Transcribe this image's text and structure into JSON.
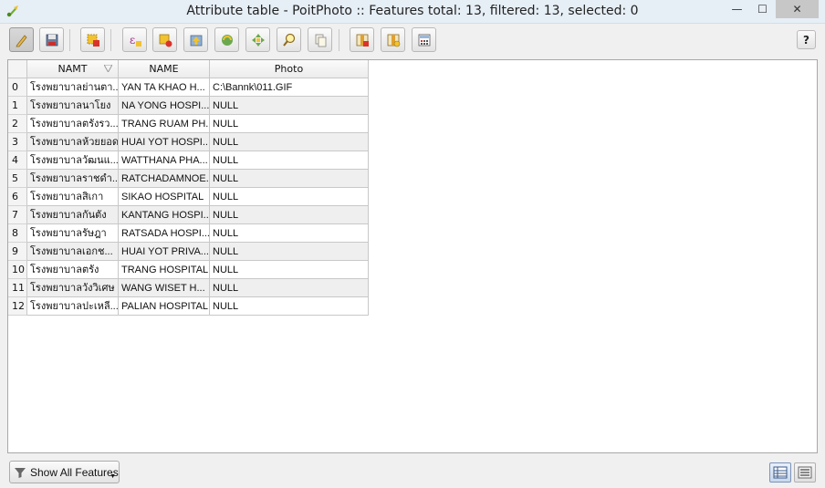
{
  "window": {
    "title": "Attribute table - PoitPhoto :: Features total: 13, filtered: 13, selected: 0",
    "minimize_glyph": "—",
    "maximize_glyph": "☐",
    "close_glyph": "✕"
  },
  "toolbar": {
    "help_label": "?",
    "icons": [
      "pencil-icon",
      "save-icon",
      "delete-selected-icon",
      "expression-select-icon",
      "deselect-icon",
      "move-selection-top-icon",
      "invert-selection-icon",
      "pan-to-selection-icon",
      "zoom-to-selection-icon",
      "copy-rows-icon",
      "delete-column-icon",
      "new-column-icon",
      "field-calculator-icon"
    ]
  },
  "table": {
    "columns": [
      "NAMT",
      "NAME",
      "Photo"
    ],
    "rows": [
      {
        "id": "0",
        "namt": "โรงพยาบาลย่านตา...",
        "name": "YAN TA KHAO H...",
        "photo": "C:\\Bannk\\011.GIF"
      },
      {
        "id": "1",
        "namt": "โรงพยาบาลนาโยง",
        "name": "NA YONG HOSPI...",
        "photo": "NULL"
      },
      {
        "id": "2",
        "namt": "โรงพยาบาลตรังรว...",
        "name": "TRANG RUAM PH...",
        "photo": "NULL"
      },
      {
        "id": "3",
        "namt": "โรงพยาบาลห้วยยอด",
        "name": "HUAI YOT HOSPI...",
        "photo": "NULL"
      },
      {
        "id": "4",
        "namt": "โรงพยาบาลวัฒนแ...",
        "name": "WATTHANA PHA...",
        "photo": "NULL"
      },
      {
        "id": "5",
        "namt": "โรงพยาบาลราชดำ...",
        "name": "RATCHADAMNOE...",
        "photo": "NULL"
      },
      {
        "id": "6",
        "namt": "โรงพยาบาลสิเกา",
        "name": "SIKAO HOSPITAL",
        "photo": "NULL"
      },
      {
        "id": "7",
        "namt": "โรงพยาบาลกันตัง",
        "name": "KANTANG HOSPI...",
        "photo": "NULL"
      },
      {
        "id": "8",
        "namt": "โรงพยาบาลรัษฎา",
        "name": "RATSADA HOSPI...",
        "photo": "NULL"
      },
      {
        "id": "9",
        "namt": "โรงพยาบาลเอกช...",
        "name": "HUAI YOT PRIVA...",
        "photo": "NULL"
      },
      {
        "id": "10",
        "namt": "โรงพยาบาลตรัง",
        "name": "TRANG HOSPITAL",
        "photo": "NULL"
      },
      {
        "id": "11",
        "namt": "โรงพยาบาลวังวิเศษ",
        "name": "WANG WISET H...",
        "photo": "NULL"
      },
      {
        "id": "12",
        "namt": "โรงพยาบาลปะเหลี...",
        "name": "PALIAN HOSPITAL",
        "photo": "NULL"
      }
    ]
  },
  "bottom": {
    "show_all_label": "Show All Features"
  },
  "colors": {
    "highlight": "#f4ff3b",
    "alt_row": "#efefef"
  }
}
